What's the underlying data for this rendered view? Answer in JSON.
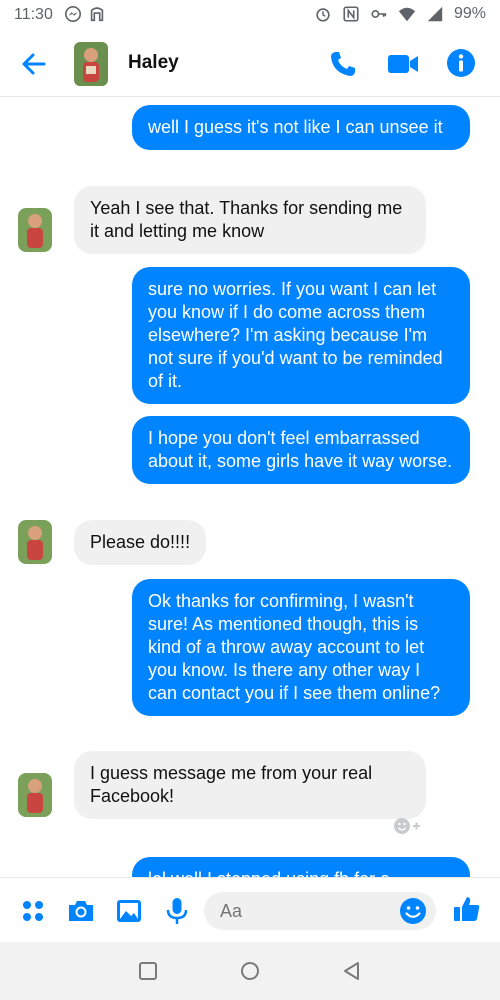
{
  "status_bar": {
    "time": "11:30",
    "battery": "99%",
    "left_icons": [
      "messenger-icon",
      "nfc-app-icon"
    ],
    "right_icons": [
      "alarm-icon",
      "nfc-icon",
      "vpn-key-icon",
      "wifi-icon",
      "signal-icon"
    ]
  },
  "header": {
    "contact_name": "Haley",
    "icons": [
      "back-arrow-icon",
      "phone-icon",
      "video-camera-icon",
      "info-icon"
    ],
    "accent_color": "#0084ff"
  },
  "messages": [
    {
      "direction": "out",
      "text": "well I guess it's not like I can unsee it"
    },
    {
      "direction": "in",
      "text": "Yeah I see that. Thanks for sending me it and letting me know"
    },
    {
      "direction": "out",
      "text": "sure no worries. If you want I can let you know if I do come across them elsewhere? I'm asking because I'm not sure if you'd want to be reminded of it."
    },
    {
      "direction": "out",
      "text": "I hope you don't feel embarrassed about it, some girls have it way worse."
    },
    {
      "direction": "in",
      "text": "Please do!!!!"
    },
    {
      "direction": "out",
      "text": "Ok thanks for confirming, I wasn't sure! As mentioned though, this is kind of a throw away account to let you know. Is there any other way I can contact you if I see them online?"
    },
    {
      "direction": "in",
      "text": "I guess message me from your real Facebook!"
    },
    {
      "direction": "out",
      "text": "lol well I stopped using fb for a"
    }
  ],
  "composer": {
    "placeholder": "Aa",
    "icons": [
      "apps-grid-icon",
      "camera-icon",
      "gallery-icon",
      "microphone-icon",
      "emoji-icon",
      "thumbs-up-icon"
    ]
  },
  "colors": {
    "outgoing_bubble": "#0084ff",
    "incoming_bubble": "#f1f0f0"
  },
  "nav_bar": {
    "icons": [
      "recent-apps-icon",
      "home-icon",
      "back-icon"
    ]
  }
}
